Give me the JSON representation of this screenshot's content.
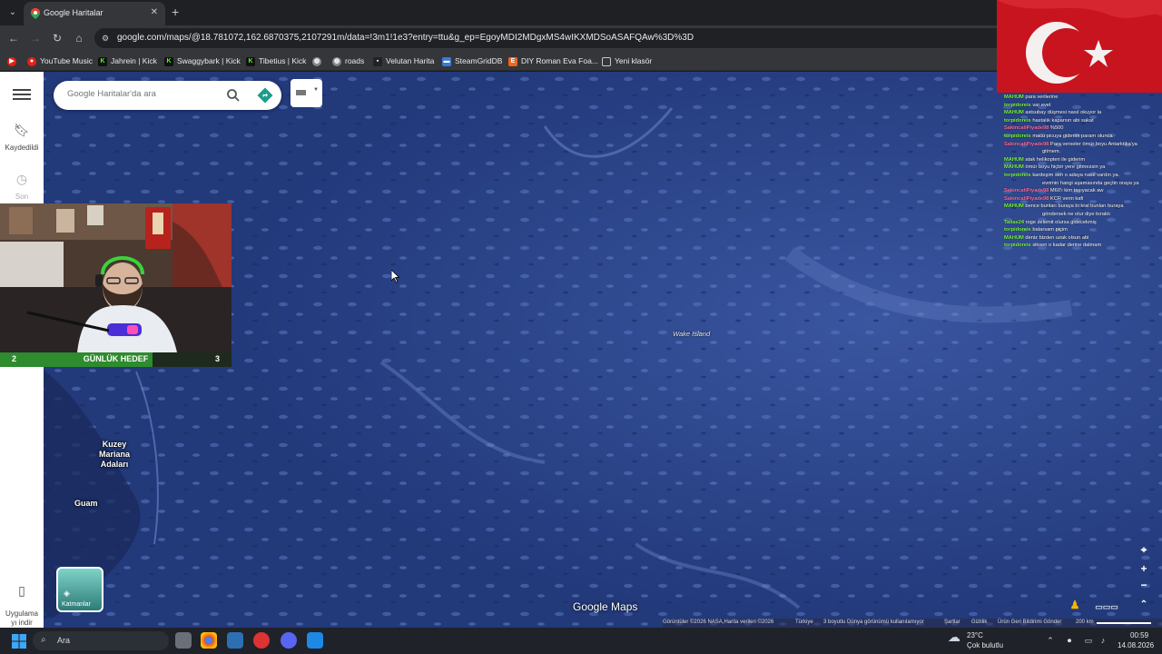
{
  "browser": {
    "tab_title": "Google Haritalar",
    "url": "google.com/maps/@18.781072,162.6870375,2107291m/data=!3m1!1e3?entry=ttu&g_ep=EgoyMDI2MDgxMS4wIKXMDSoASAFQAw%3D%3D",
    "bookmarks": [
      {
        "label": "YouTube Music",
        "icon": "youtube-music-icon",
        "color": "#e62117"
      },
      {
        "label": "Jahrein | Kick",
        "icon": "kick-icon",
        "color": "#53fc18"
      },
      {
        "label": "Swaggybark | Kick",
        "icon": "kick-icon",
        "color": "#53fc18"
      },
      {
        "label": "Tibetius | Kick",
        "icon": "kick-icon",
        "color": "#53fc18"
      },
      {
        "label": "",
        "icon": "globe-icon",
        "color": "#bbbbbb"
      },
      {
        "label": "roads",
        "icon": "globe-icon",
        "color": "#bbbbbb"
      },
      {
        "label": "Velutan Harita",
        "icon": "site-icon",
        "color": "#222222"
      },
      {
        "label": "SteamGridDB",
        "icon": "steamgriddb-icon",
        "color": "#3b7bd4"
      },
      {
        "label": "DIY Roman Eva Foa...",
        "icon": "etsy-icon",
        "color": "#f1641e"
      },
      {
        "label": "Yeni klasör",
        "icon": "folder-icon",
        "color": "#c8c8c8"
      }
    ]
  },
  "maps": {
    "search_placeholder": "Google Haritalar'da ara",
    "rail_saved": "Kaydedildi",
    "rail_recent": "Son",
    "rail_app": "Uygulama\nyı indir",
    "layers_label": "Katmanlar",
    "brand": "Google Maps",
    "labels": {
      "mariana": "Kuzey\nMariana\nAdaları",
      "guam": "Guam",
      "wake": "Wake Island"
    },
    "attribution": {
      "imagery": "Görüntüler ©2026 NASA,Harita verileri ©2026",
      "country": "Türkiye",
      "view3d": "3 boyutlu Dünya görünümü kullanılamıyor",
      "terms": "Şartlar",
      "privacy": "Gizlilik",
      "feedback": "Ürün Geri Bildirimi Gönder",
      "scale": "200 km"
    }
  },
  "stream": {
    "goal_label": "GÜNLÜK HEDEF",
    "goal_current": "2",
    "goal_target": "3",
    "goal_fill_fraction": 0.66
  },
  "chat": [
    {
      "user": "MAHUM",
      "color": "#7cfc3c",
      "text": "para verilerine"
    },
    {
      "user": "torpidoreis",
      "color": "#7cfc3c",
      "text": "var evet"
    },
    {
      "user": "MAHUM",
      "color": "#7cfc3c",
      "text": "astsubay düşmesi nasıl okuyor la"
    },
    {
      "user": "torpidoreis",
      "color": "#7cfc3c",
      "text": "hastalık kaparsın abi sakat"
    },
    {
      "user": "SakincaliPiyade98",
      "color": "#ff6fa5",
      "text": "%500"
    },
    {
      "user": "torpidoreis",
      "color": "#7cfc3c",
      "text": "macu picuya giderim param olunca"
    },
    {
      "user": "SakincaliPiyade98",
      "color": "#ff6fa5",
      "text": "Para verseler ömür boyu Antarktika'ya"
    },
    {
      "user": "",
      "color": "#ffffff",
      "text": "gitmem."
    },
    {
      "user": "MAHUM",
      "color": "#7cfc3c",
      "text": "atak helikopteri ile giderim"
    },
    {
      "user": "MAHUM",
      "color": "#7cfc3c",
      "text": "ömür boyu hiçbir yere gitmezsin ya"
    },
    {
      "user": "torpidoreis",
      "color": "#7cfc3c",
      "text": "kardeşim sen o adaya nasıl vardın ya."
    },
    {
      "user": "",
      "color": "#ffffff",
      "text": "evrimin hangi aşamasında geçtin oraya ya"
    },
    {
      "user": "SakincaliPiyade98",
      "color": "#ff6fa5",
      "text": "M60'ı kim taşıyacak aw"
    },
    {
      "user": "SakincaliPiyade98",
      "color": "#ff6fa5",
      "text": "KCR verin kafi"
    },
    {
      "user": "MAHUM",
      "color": "#7cfc3c",
      "text": "bence bunları buraya bi kral bunları buraya"
    },
    {
      "user": "",
      "color": "#ffffff",
      "text": "göndersek ne olur diye bıraktı"
    },
    {
      "user": "Talias24",
      "color": "#7cfc3c",
      "text": "roge zelemit olursa gidecekmiş"
    },
    {
      "user": "torpidoreis",
      "color": "#7cfc3c",
      "text": "batarsam piçim"
    },
    {
      "user": "MAHUM",
      "color": "#7cfc3c",
      "text": "deniz bizden uzak olsun abi"
    },
    {
      "user": "torpidoreis",
      "color": "#7cfc3c",
      "text": "siksen o kadar derine dalmam"
    }
  ],
  "taskbar": {
    "search_label": "Ara",
    "weather_temp": "23°C",
    "weather_desc": "Çok bulutlu",
    "time": "00:59",
    "date": "14.08.2026"
  }
}
